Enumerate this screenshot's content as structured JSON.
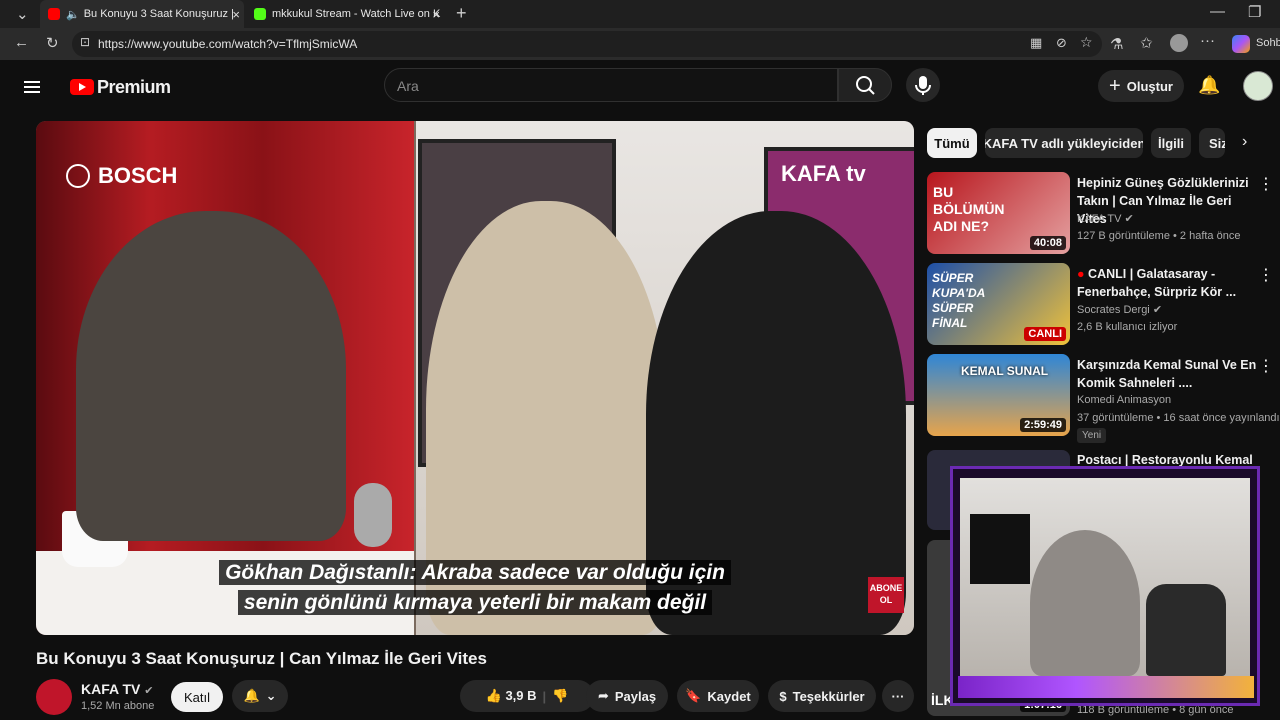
{
  "browser": {
    "tabs": [
      {
        "title": "Bu Konuyu 3 Saat Konuşuruz |"
      },
      {
        "title": "mkkukul Stream - Watch Live on K"
      }
    ],
    "url": "https://www.youtube.com/watch?v=TflmjSmicWA",
    "copilot_label": "Sohb"
  },
  "header": {
    "brand": "Premium",
    "search_placeholder": "Ara",
    "create_label": "Oluştur"
  },
  "video": {
    "overlay_brand_left": "BOSCH",
    "overlay_brand_right": "KAFA tv",
    "subtitle_line1": "Gökhan Dağıstanlı: Akraba sadece var olduğu için",
    "subtitle_line2": "senin gönlünü kırmaya yeterli bir makam değil",
    "abone_badge": "ABONE OL",
    "title": "Bu Konuyu 3 Saat Konuşuruz | Can Yılmaz İle Geri Vites"
  },
  "channel": {
    "name": "KAFA TV",
    "subscribers": "1,52 Mn abone",
    "join_label": "Katıl"
  },
  "actions": {
    "like_count": "3,9 B",
    "share_label": "Paylaş",
    "save_label": "Kaydet",
    "thanks_label": "Teşekkürler"
  },
  "chips": [
    "Tümü",
    "KAFA TV adlı yükleyiciden",
    "İlgili",
    "Sizin için"
  ],
  "recommendations": [
    {
      "title": "Hepiniz Güneş Gözlüklerinizi Takın | Can Yılmaz İle Geri Vites",
      "channel": "KAFA TV",
      "meta": "127 B görüntüleme • 2 hafta önce",
      "duration": "40:08",
      "thumb_text": "BU BÖLÜMÜN ADI NE?"
    },
    {
      "title": "CANLI | Galatasaray - Fenerbahçe, Sürpriz Kör ...",
      "channel": "Socrates Dergi",
      "meta": "2,6 B kullanıcı izliyor",
      "duration": "CANLI",
      "thumb_text": "SÜPER KUPA'DA SÜPER FİNAL"
    },
    {
      "title": "Karşınızda Kemal Sunal Ve En Komik Sahneleri ....",
      "channel": "Komedi Animasyon",
      "meta": "37 görüntüleme • 16 saat önce yayınlandı",
      "duration": "2:59:49",
      "badge": "Yeni",
      "thumb_text": "KEMAL SUNAL"
    },
    {
      "title": "Postacı | Restorayonlu Kemal",
      "channel": "",
      "meta": "",
      "duration": ""
    },
    {
      "title": "",
      "channel": "",
      "meta": "118 B görüntüleme • 8 gün önce",
      "duration": "1:07:16",
      "thumb_text": "İLKER"
    }
  ],
  "colors": {
    "youtube_red": "#ff0000",
    "bg": "#0f0f0f",
    "chip_bg": "#272727"
  }
}
